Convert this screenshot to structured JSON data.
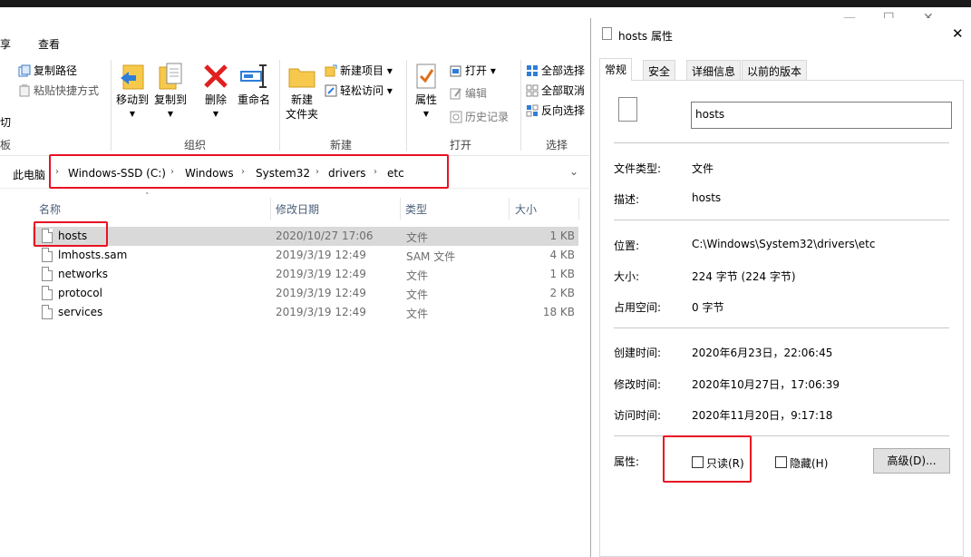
{
  "ribbon": {
    "tabs": [
      "享",
      "查看"
    ],
    "clipboard": {
      "copy_path": "复制路径",
      "paste_shortcut": "粘贴快捷方式",
      "cut": "切",
      "group_label": "板"
    },
    "organize": {
      "move_to": "移动到",
      "copy_to": "复制到",
      "delete": "删除",
      "rename": "重命名",
      "group_label": "组织"
    },
    "new": {
      "new_folder": "新建\n文件夹",
      "new_folder_l1": "新建",
      "new_folder_l2": "文件夹",
      "new_item": "新建项目 ▾",
      "easy_access": "轻松访问 ▾",
      "group_label": "新建"
    },
    "open": {
      "properties": "属性",
      "open": "打开 ▾",
      "edit": "编辑",
      "history": "历史记录",
      "group_label": "打开"
    },
    "select": {
      "select_all": "全部选择",
      "select_none": "全部取消",
      "invert": "反向选择",
      "group_label": "选择"
    }
  },
  "address": {
    "crumbs": [
      "此电脑",
      "Windows-SSD (C:)",
      "Windows",
      "System32",
      "drivers",
      "etc"
    ]
  },
  "list": {
    "columns": {
      "name": "名称",
      "date": "修改日期",
      "type": "类型",
      "size": "大小"
    },
    "rows": [
      {
        "name": "hosts",
        "date": "2020/10/27 17:06",
        "type": "文件",
        "size": "1 KB"
      },
      {
        "name": "lmhosts.sam",
        "date": "2019/3/19 12:49",
        "type": "SAM 文件",
        "size": "4 KB"
      },
      {
        "name": "networks",
        "date": "2019/3/19 12:49",
        "type": "文件",
        "size": "1 KB"
      },
      {
        "name": "protocol",
        "date": "2019/3/19 12:49",
        "type": "文件",
        "size": "2 KB"
      },
      {
        "name": "services",
        "date": "2019/3/19 12:49",
        "type": "文件",
        "size": "18 KB"
      }
    ]
  },
  "dialog": {
    "title": "hosts 属性",
    "tabs": [
      "常规",
      "安全",
      "详细信息",
      "以前的版本"
    ],
    "filename": "hosts",
    "file_type_label": "文件类型:",
    "file_type": "文件",
    "desc_label": "描述:",
    "desc": "hosts",
    "location_label": "位置:",
    "location": "C:\\Windows\\System32\\drivers\\etc",
    "size_label": "大小:",
    "size": "224 字节 (224 字节)",
    "disk_label": "占用空间:",
    "disk": "0 字节",
    "created_label": "创建时间:",
    "created": "2020年6月23日，22:06:45",
    "modified_label": "修改时间:",
    "modified": "2020年10月27日，17:06:39",
    "accessed_label": "访问时间:",
    "accessed": "2020年11月20日，9:17:18",
    "attr_label": "属性:",
    "readonly": "只读(R)",
    "hidden": "隐藏(H)",
    "advanced": "高级(D)..."
  }
}
